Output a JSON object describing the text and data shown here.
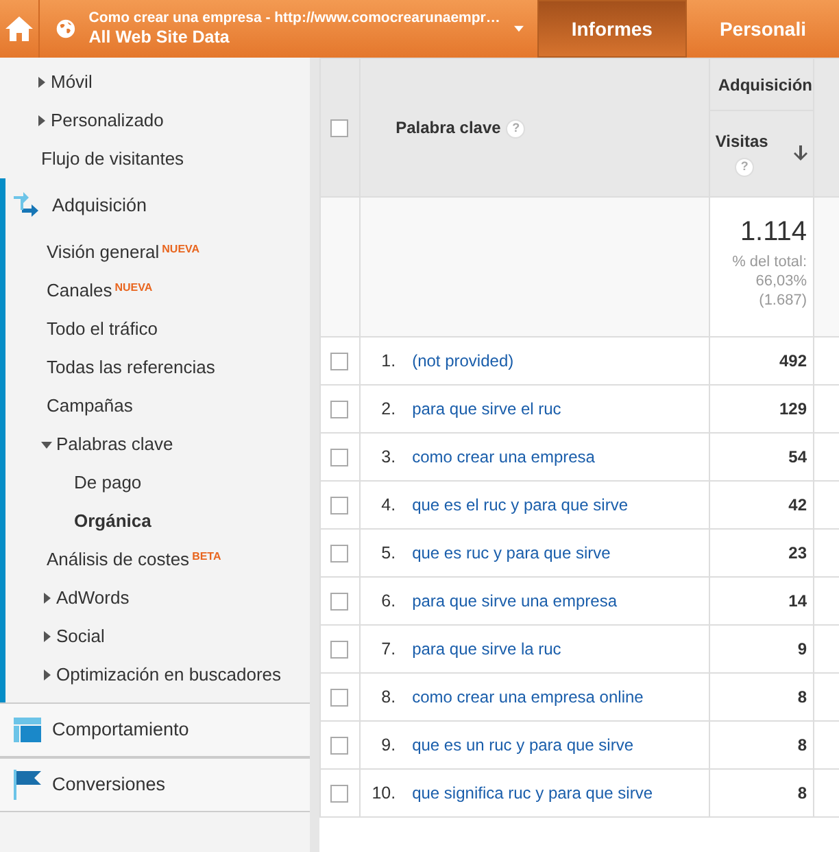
{
  "header": {
    "account_title": "Como crear una empresa - http://www.comocrearunaempr…",
    "account_view": "All Web Site Data",
    "tabs": [
      {
        "label": "Informes",
        "selected": true
      },
      {
        "label": "Personali",
        "selected": false
      }
    ]
  },
  "sidebar": {
    "sections": [
      {
        "kind": "partial",
        "children": [
          {
            "label": "Móvil",
            "kind": "group",
            "expanded": false,
            "selected": false
          },
          {
            "label": "Personalizado",
            "kind": "group",
            "expanded": false,
            "selected": false
          },
          {
            "label": "Flujo de visitantes",
            "kind": "link",
            "selected": false
          }
        ]
      },
      {
        "kind": "section",
        "label": "Adquisición",
        "expanded": true,
        "children": [
          {
            "label": "Visión general",
            "badge": "NUEVA",
            "kind": "link",
            "selected": false
          },
          {
            "label": "Canales",
            "badge": "NUEVA",
            "kind": "link",
            "selected": false
          },
          {
            "label": "Todo el tráfico",
            "kind": "link",
            "selected": false
          },
          {
            "label": "Todas las referencias",
            "kind": "link",
            "selected": false
          },
          {
            "label": "Campañas",
            "kind": "link",
            "selected": false
          },
          {
            "label": "Palabras clave",
            "kind": "group",
            "expanded": true,
            "selected": false,
            "children": [
              {
                "label": "De pago",
                "kind": "link",
                "selected": false
              },
              {
                "label": "Orgánica",
                "kind": "link",
                "selected": true
              }
            ]
          },
          {
            "label": "Análisis de costes",
            "badge": "BETA",
            "kind": "link",
            "selected": false
          },
          {
            "label": "AdWords",
            "kind": "group",
            "expanded": false,
            "selected": false
          },
          {
            "label": "Social",
            "kind": "group",
            "expanded": false,
            "selected": false
          },
          {
            "label": "Optimización en buscadores",
            "kind": "group",
            "expanded": false,
            "selected": false
          }
        ]
      },
      {
        "kind": "section",
        "label": "Comportamiento",
        "expanded": false
      },
      {
        "kind": "section",
        "label": "Conversiones",
        "expanded": false
      }
    ]
  },
  "table": {
    "select_all_checked": false,
    "keyword_column": "Palabra clave",
    "keyword_help": "?",
    "metric_help": "?",
    "group_column": "Adquisición",
    "metric_column": "Visitas",
    "total": {
      "value": "1.114",
      "share_label": "% del total:",
      "share": "66,03%",
      "overall": "(1.687)"
    },
    "rows": [
      {
        "index": "1.",
        "keyword": "(not provided)",
        "visits": "492",
        "checked": false
      },
      {
        "index": "2.",
        "keyword": "para que sirve el ruc",
        "visits": "129",
        "checked": false
      },
      {
        "index": "3.",
        "keyword": "como crear una empresa",
        "visits": "54",
        "checked": false
      },
      {
        "index": "4.",
        "keyword": "que es el ruc y para que sirve",
        "visits": "42",
        "checked": false
      },
      {
        "index": "5.",
        "keyword": "que es ruc y para que sirve",
        "visits": "23",
        "checked": false
      },
      {
        "index": "6.",
        "keyword": "para que sirve una empresa",
        "visits": "14",
        "checked": false
      },
      {
        "index": "7.",
        "keyword": "para que sirve la ruc",
        "visits": "9",
        "checked": false
      },
      {
        "index": "8.",
        "keyword": "como crear una empresa online",
        "visits": "8",
        "checked": false
      },
      {
        "index": "9.",
        "keyword": "que es un ruc y para que sirve",
        "visits": "8",
        "checked": false
      },
      {
        "index": "10.",
        "keyword": "que significa ruc y para que sirve",
        "visits": "8",
        "checked": false
      }
    ]
  }
}
